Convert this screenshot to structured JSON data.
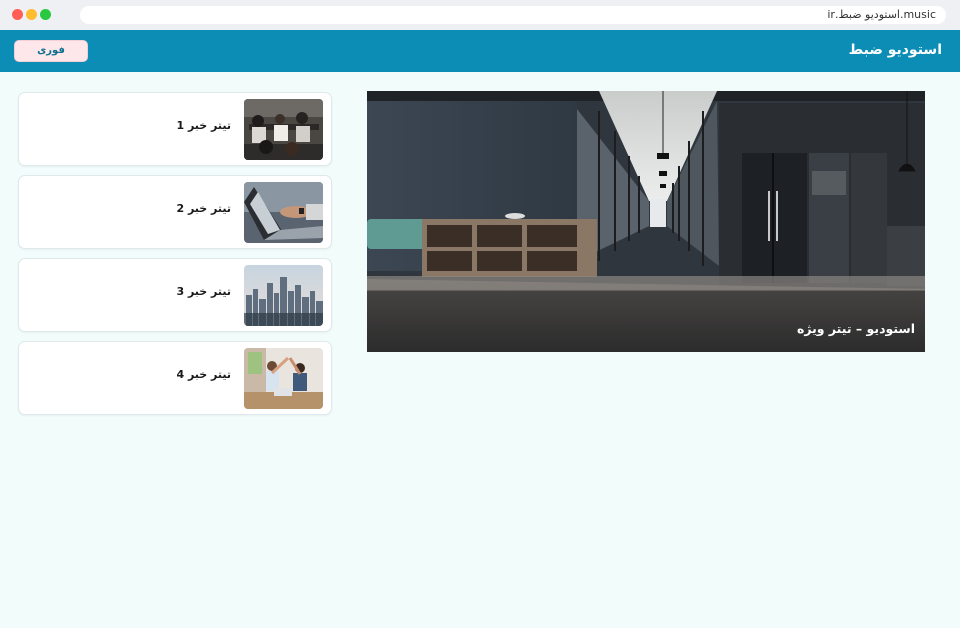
{
  "browser": {
    "url": "music.استودیو ضبط.ir"
  },
  "header": {
    "site_title": "استودیو ضبط",
    "breaking_label": "فوری"
  },
  "hero": {
    "caption": "استودیو – تیتر ویژه"
  },
  "news": [
    {
      "title": "تیتر خبر 1"
    },
    {
      "title": "تیتر خبر 2"
    },
    {
      "title": "تیتر خبر 3"
    },
    {
      "title": "تیتر خبر 4"
    }
  ],
  "colors": {
    "header_bg": "#0c8db5",
    "page_bg": "#f2fcfa",
    "breaking_bg": "#fde7ea"
  }
}
